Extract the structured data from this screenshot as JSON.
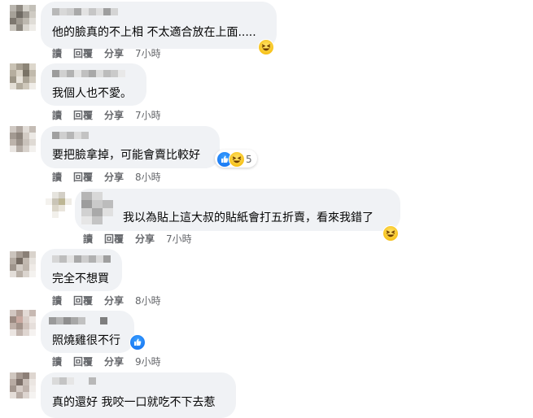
{
  "comments": [
    {
      "text": "他的臉真的不上相 不太適合放在上面.....",
      "read": "讀",
      "reply": "回覆",
      "share": "分享",
      "time": "7小時"
    },
    {
      "text": "我個人也不愛。",
      "read": "讀",
      "reply": "回覆",
      "share": "分享",
      "time": "7小時"
    },
    {
      "text": "要把臉拿掉，可能會賣比較好",
      "read": "讀",
      "reply": "回覆",
      "share": "分享",
      "time": "8小時",
      "reaction_count": "5"
    },
    {
      "text": "我以為貼上這大叔的貼紙會打五折賣，看來我錯了",
      "read": "讀",
      "reply": "回覆",
      "share": "分享",
      "time": "7小時"
    },
    {
      "text": "完全不想買",
      "read": "讀",
      "reply": "回覆",
      "share": "分享",
      "time": "8小時"
    },
    {
      "text": "照燒雞很不行",
      "read": "讀",
      "reply": "回覆",
      "share": "分享",
      "time": "9小時"
    },
    {
      "text": "真的還好 我咬一口就吃不下去惹"
    }
  ],
  "colors": {
    "bubble": "#f0f2f5",
    "action_text": "#65676b",
    "like_blue": "#1877f2",
    "haha_yellow": "#f7c21a"
  },
  "icons": [
    "avatar-blurred",
    "haha-reaction-icon",
    "like-reaction-icon"
  ]
}
